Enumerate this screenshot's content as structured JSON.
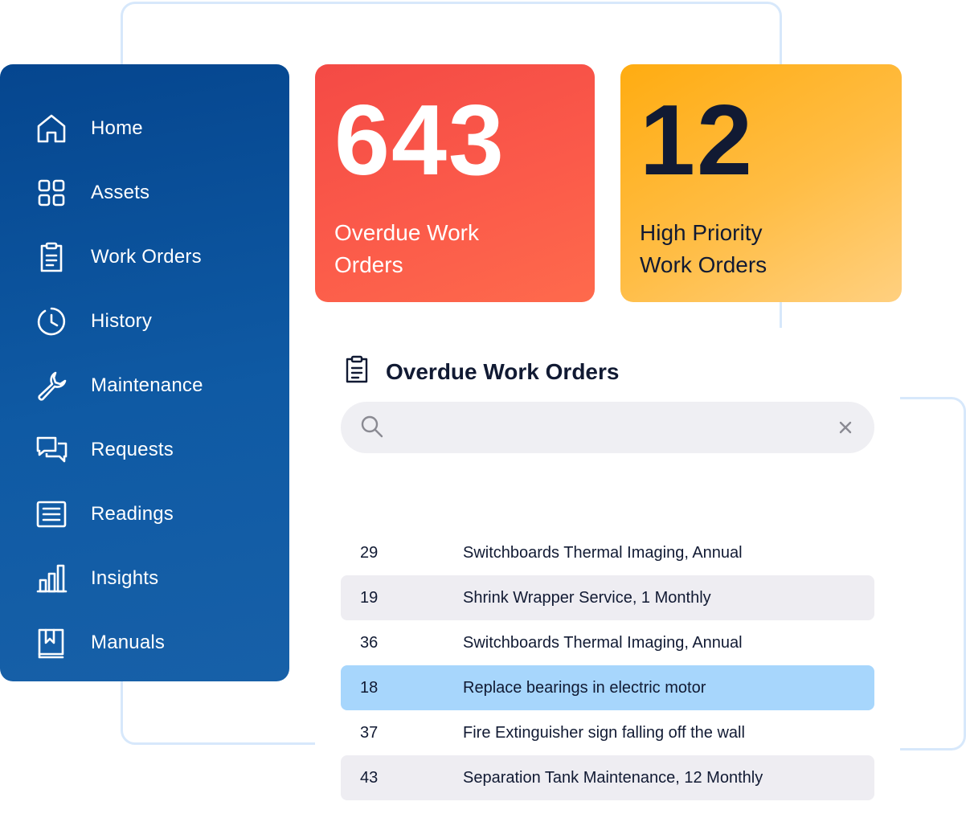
{
  "sidebar": {
    "items": [
      {
        "label": "Home",
        "icon": "home-icon"
      },
      {
        "label": "Assets",
        "icon": "grid-icon"
      },
      {
        "label": "Work Orders",
        "icon": "clipboard-icon"
      },
      {
        "label": "History",
        "icon": "history-icon"
      },
      {
        "label": "Maintenance",
        "icon": "wrench-icon"
      },
      {
        "label": "Requests",
        "icon": "chat-icon"
      },
      {
        "label": "Readings",
        "icon": "readings-icon"
      },
      {
        "label": "Insights",
        "icon": "bar-chart-icon"
      },
      {
        "label": "Manuals",
        "icon": "book-icon"
      }
    ]
  },
  "cards": {
    "overdue": {
      "value": "643",
      "label": "Overdue Work Orders",
      "color": "#f44a45"
    },
    "priority": {
      "value": "12",
      "label": "High Priority Work Orders",
      "color": "#ffac11"
    }
  },
  "panel": {
    "title": "Overdue Work Orders",
    "search": {
      "value": "",
      "placeholder": ""
    },
    "rows": [
      {
        "id": "29",
        "description": "Switchboards Thermal Imaging, Annual"
      },
      {
        "id": "19",
        "description": "Shrink Wrapper Service, 1 Monthly"
      },
      {
        "id": "36",
        "description": "Switchboards Thermal Imaging, Annual"
      },
      {
        "id": "18",
        "description": "Replace bearings in electric motor",
        "selected": true
      },
      {
        "id": "37",
        "description": "Fire Extinguisher sign falling off the wall"
      },
      {
        "id": "43",
        "description": "Separation Tank Maintenance, 12 Monthly"
      }
    ]
  },
  "colors": {
    "sidebar": "#05468f",
    "selected_row": "#a7d6fc",
    "shaded_row": "#eeedf2",
    "text_dark": "#111a33"
  }
}
